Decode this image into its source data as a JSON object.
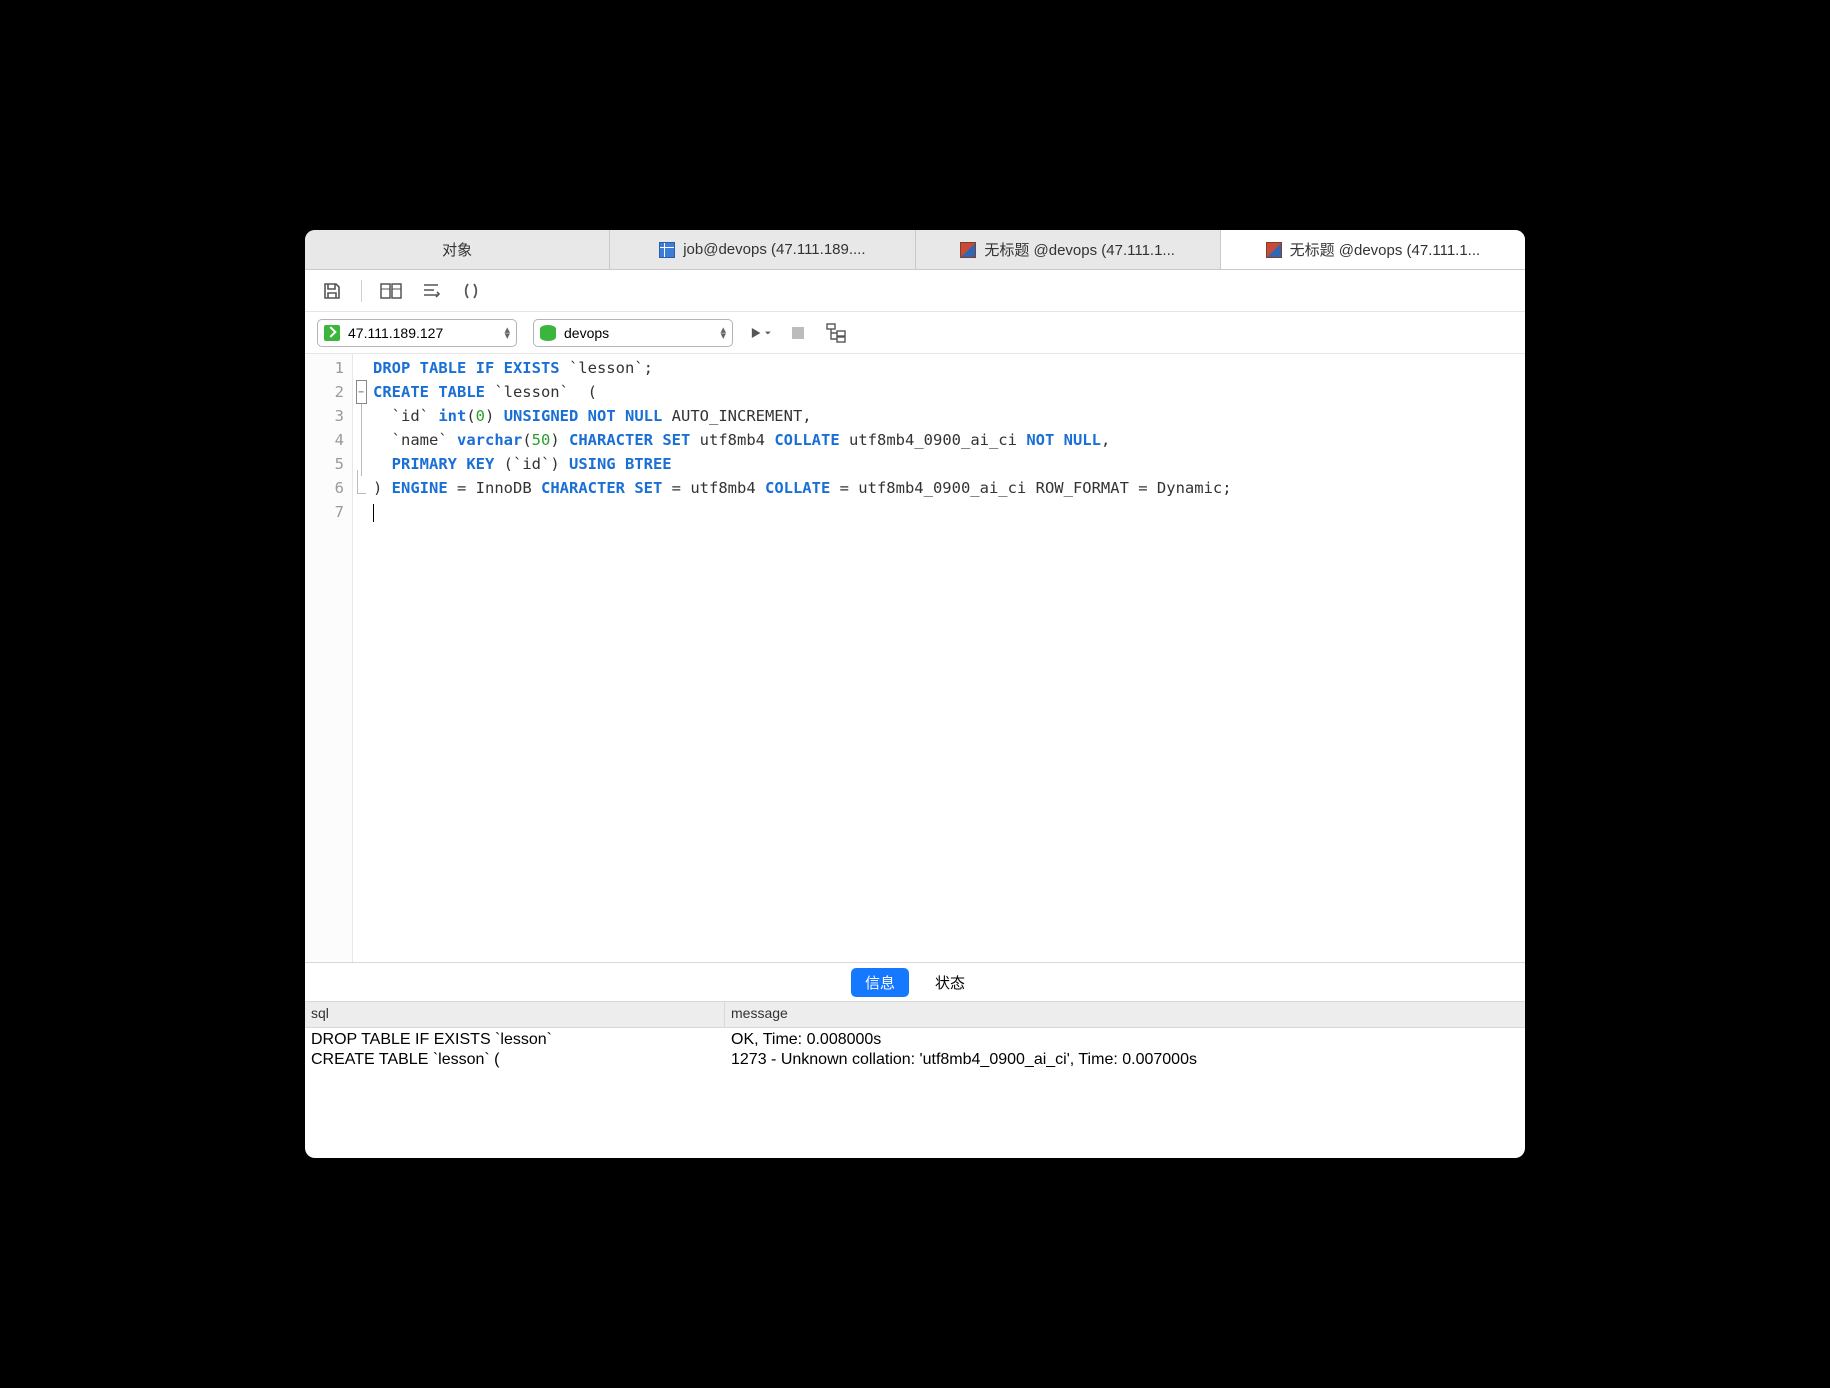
{
  "tabs": [
    {
      "label": "对象",
      "icon": null
    },
    {
      "label": "job@devops (47.111.189....",
      "icon": "table"
    },
    {
      "label": "无标题 @devops (47.111.1...",
      "icon": "query"
    },
    {
      "label": "无标题 @devops (47.111.1...",
      "icon": "query",
      "active": true
    }
  ],
  "connection": {
    "host": "47.111.189.127",
    "db": "devops"
  },
  "code": {
    "lines": [
      [
        {
          "t": "DROP TABLE IF EXISTS",
          "c": "kw"
        },
        {
          "t": " `lesson`;",
          "c": "id"
        }
      ],
      [
        {
          "t": "CREATE TABLE",
          "c": "kw"
        },
        {
          "t": " `lesson`  (",
          "c": "id"
        }
      ],
      [
        {
          "t": "  `id` ",
          "c": "id"
        },
        {
          "t": "int",
          "c": "ty"
        },
        {
          "t": "(",
          "c": "id"
        },
        {
          "t": "0",
          "c": "num"
        },
        {
          "t": ") ",
          "c": "id"
        },
        {
          "t": "UNSIGNED NOT NULL",
          "c": "kw"
        },
        {
          "t": " AUTO_INCREMENT,",
          "c": "id"
        }
      ],
      [
        {
          "t": "  `name` ",
          "c": "id"
        },
        {
          "t": "varchar",
          "c": "ty"
        },
        {
          "t": "(",
          "c": "id"
        },
        {
          "t": "50",
          "c": "num"
        },
        {
          "t": ") ",
          "c": "id"
        },
        {
          "t": "CHARACTER SET",
          "c": "kw"
        },
        {
          "t": " utf8mb4 ",
          "c": "id"
        },
        {
          "t": "COLLATE",
          "c": "kw"
        },
        {
          "t": " utf8mb4_0900_ai_ci ",
          "c": "id"
        },
        {
          "t": "NOT NULL",
          "c": "kw"
        },
        {
          "t": ",",
          "c": "id"
        }
      ],
      [
        {
          "t": "  ",
          "c": "id"
        },
        {
          "t": "PRIMARY KEY",
          "c": "kw"
        },
        {
          "t": " (`id`) ",
          "c": "id"
        },
        {
          "t": "USING BTREE",
          "c": "kw"
        }
      ],
      [
        {
          "t": ") ",
          "c": "id"
        },
        {
          "t": "ENGINE",
          "c": "kw"
        },
        {
          "t": " = InnoDB ",
          "c": "id"
        },
        {
          "t": "CHARACTER SET",
          "c": "kw"
        },
        {
          "t": " = utf8mb4 ",
          "c": "id"
        },
        {
          "t": "COLLATE",
          "c": "kw"
        },
        {
          "t": " = utf8mb4_0900_ai_ci ROW_FORMAT = Dynamic;",
          "c": "id"
        }
      ],
      []
    ]
  },
  "result_tabs": {
    "info": "信息",
    "status": "状态"
  },
  "result_headers": {
    "sql": "sql",
    "message": "message"
  },
  "results": [
    {
      "sql": "DROP TABLE IF EXISTS `lesson`",
      "message": "OK, Time: 0.008000s"
    },
    {
      "sql": "CREATE TABLE `lesson`  (",
      "message": "1273 - Unknown collation: 'utf8mb4_0900_ai_ci', Time: 0.007000s"
    }
  ]
}
